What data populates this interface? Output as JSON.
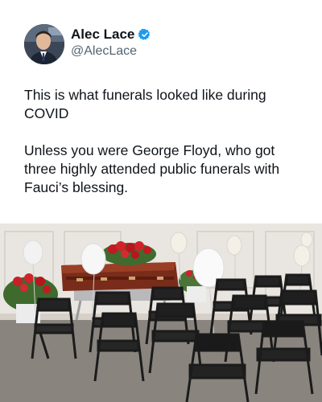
{
  "author": {
    "display_name": "Alec Lace",
    "handle": "@AlecLace",
    "verified": true,
    "verified_icon": "verified-badge-icon",
    "verified_color": "#1d9bf0"
  },
  "tweet": {
    "line1": "This is what funerals looked like during COVID",
    "line2": "Unless you were George Floyd, who got three highly attended public funerals with Fauci’s blessing."
  },
  "colors": {
    "text": "#0f1419",
    "secondary_text": "#536471"
  }
}
